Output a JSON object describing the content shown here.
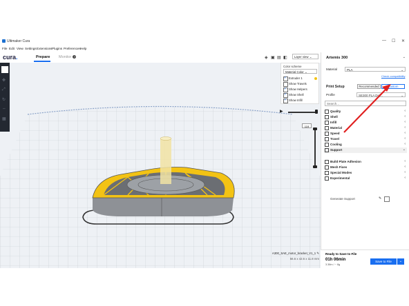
{
  "window": {
    "title": "Ultimaker Cura",
    "min": "—",
    "max": "☐",
    "close": "✕"
  },
  "menu": [
    "File",
    "Edit",
    "View",
    "Settings",
    "Extensions",
    "Plugins",
    "Preferences",
    "Help"
  ],
  "header": {
    "logo": "cura",
    "logo_dot": ".",
    "tabs": [
      {
        "label": "Prepare",
        "active": true
      },
      {
        "label": "Monitor",
        "active": false
      }
    ],
    "monitor_badge": "?"
  },
  "printer": {
    "name": "Artemis 300"
  },
  "view": {
    "layer_view_select": "Layer view"
  },
  "color_panel": {
    "label": "Color scheme",
    "value": "Material Color",
    "options": [
      {
        "label": "Extruder 1",
        "checked": true,
        "swatch": "#f3c314"
      },
      {
        "label": "Show Travels",
        "checked": false
      },
      {
        "label": "Show Helpers",
        "checked": true
      },
      {
        "label": "Show Shell",
        "checked": true
      },
      {
        "label": "Show Infill",
        "checked": true
      }
    ]
  },
  "layer": {
    "current": "119"
  },
  "object": {
    "filename": "A300_SAE_motor_bracket_V1_1",
    "dimensions": "56.6 x 42.6 x 11.8 mm"
  },
  "material": {
    "label": "Material",
    "value": "PLA",
    "link": "Check compatibility"
  },
  "print_setup": {
    "title": "Print Setup",
    "modes": [
      {
        "label": "Recommended",
        "active": false
      },
      {
        "label": "Custom",
        "active": true
      }
    ],
    "profile_label": "Profile",
    "profile_value": "SE300 PLA Def...",
    "search_placeholder": "Search...",
    "categories": [
      {
        "label": "Quality",
        "open": false
      },
      {
        "label": "Shell",
        "open": false
      },
      {
        "label": "Infill",
        "open": false
      },
      {
        "label": "Material",
        "open": false
      },
      {
        "label": "Speed",
        "open": false
      },
      {
        "label": "Travel",
        "open": false
      },
      {
        "label": "Cooling",
        "open": false
      },
      {
        "label": "Support",
        "open": true
      },
      {
        "label": "Build Plate Adhesion",
        "open": false
      },
      {
        "label": "Mesh Fixes",
        "open": false
      },
      {
        "label": "Special Modes",
        "open": false
      },
      {
        "label": "Experimental",
        "open": false
      }
    ],
    "generate_support": "Generate Support"
  },
  "output": {
    "status": "Ready to Save to File",
    "time": "01h 06min",
    "stats": "3.38m / ~ 8g",
    "save_label": "Save to File"
  },
  "colors": {
    "accent": "#196ef0",
    "toolbar": "#232831",
    "annotation_arrow": "#e02020",
    "model_gray": "#8e9196",
    "infill_yellow": "#f3c314"
  }
}
